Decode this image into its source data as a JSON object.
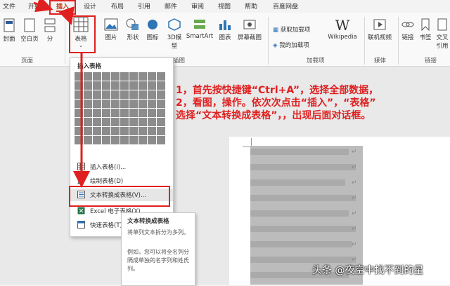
{
  "tabs": [
    "文件",
    "开始",
    "插入",
    "设计",
    "布局",
    "引用",
    "邮件",
    "审阅",
    "视图",
    "帮助",
    "百度网盘"
  ],
  "active_tab": "插入",
  "ribbon": {
    "pages_group": {
      "cover": "封面",
      "blank": "空白页",
      "break": "分",
      "label": "页面"
    },
    "table_btn": "表格",
    "pictures": "图片",
    "shapes": "形状",
    "icons": "图标",
    "model3d": "3D模型",
    "smartart": "SmartArt",
    "chart": "图表",
    "screenshot": "屏幕截图",
    "illustrations_label": "插图",
    "get_addins": "获取加载项",
    "my_addins": "我的加载项",
    "wikipedia": "Wikipedia",
    "addins_label": "加载项",
    "online_video": "联机视频",
    "media_label": "媒体",
    "link": "链接",
    "bookmark": "书签",
    "crossref": "交叉引用",
    "links_label": "链接"
  },
  "dropdown": {
    "title": "插入表格",
    "items": [
      "插入表格(I)...",
      "绘制表格(D)",
      "文本转换成表格(V)...",
      "Excel 电子表格(X)",
      "快速表格(T)"
    ]
  },
  "tooltip": {
    "title": "文本转换成表格",
    "p1": "将单列文本拆分为多列。",
    "p2": "例如，您可以将全名列分隔成单独的名字列和姓氏列。"
  },
  "annotation": {
    "line1": "1，首先按快捷键“Ctrl+A”，选择全部数据，",
    "line2": "2，看图，操作。依次次点击“插入”，“表格”",
    "line3": "选择“文本转换成表格”，，出现后面对话框。"
  },
  "watermark": "头条 @夜空中找不到的星",
  "colors": {
    "accent": "#c43e1c",
    "annotation_red": "#e02020"
  }
}
